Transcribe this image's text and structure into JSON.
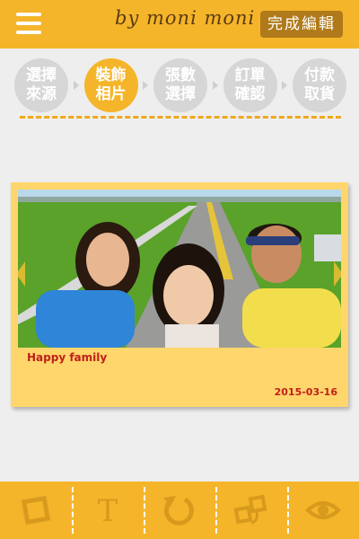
{
  "header": {
    "brand": "by moni moni",
    "done_label": "完成編輯"
  },
  "steps": [
    {
      "label": "選擇\n來源",
      "active": false
    },
    {
      "label": "裝飾\n相片",
      "active": true
    },
    {
      "label": "張數\n選擇",
      "active": false
    },
    {
      "label": "訂單\n確認",
      "active": false
    },
    {
      "label": "付款\n取貨",
      "active": false
    }
  ],
  "card": {
    "caption": "Happy family",
    "date": "2015-03-16"
  },
  "toolbar": {
    "icons": [
      "frame-icon",
      "text-icon",
      "rotate-icon",
      "replace-photo-icon",
      "preview-eye-icon"
    ]
  },
  "colors": {
    "accent": "#f5b52a",
    "step_inactive": "#d6d6d6",
    "card_bg": "#ffd66b",
    "caption_text": "#c0201a"
  }
}
